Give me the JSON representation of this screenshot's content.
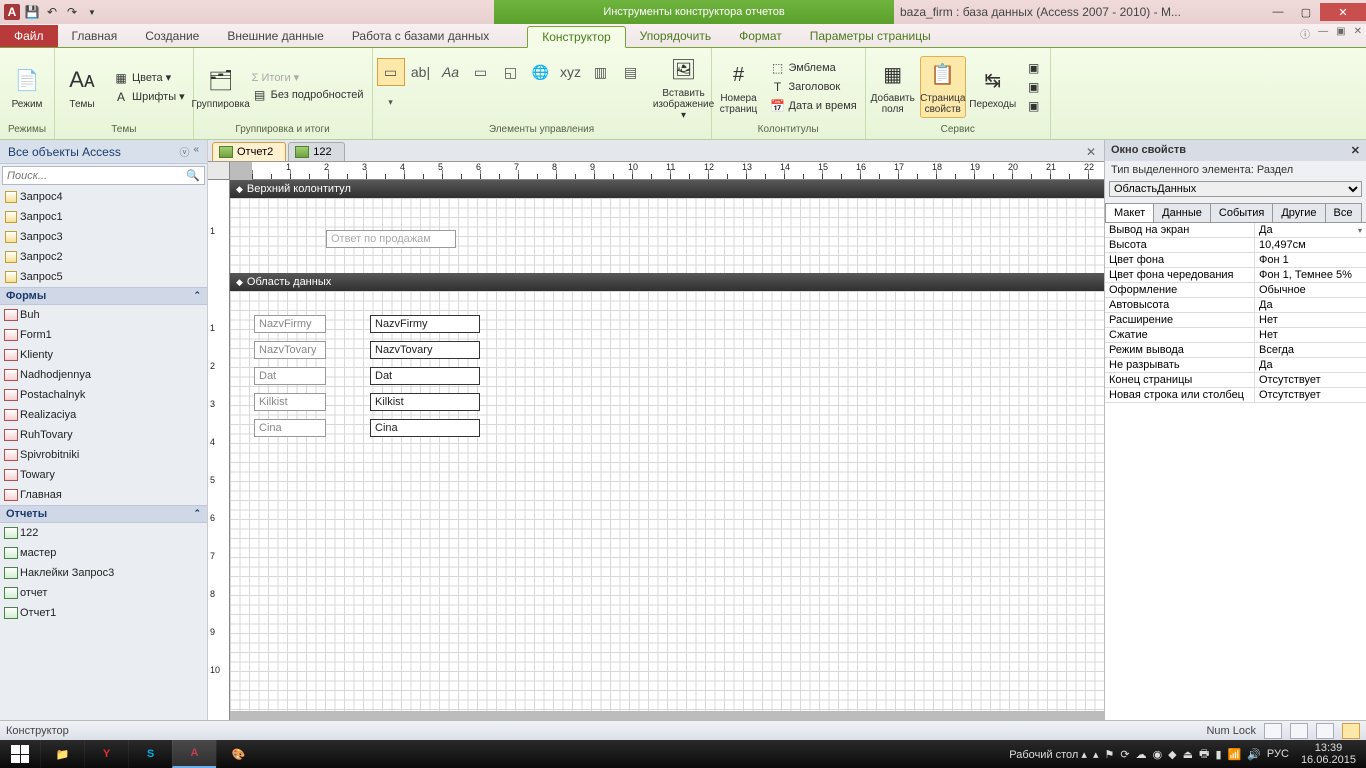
{
  "window": {
    "context_tab_title": "Инструменты конструктора отчетов",
    "doc_title": "baza_firm : база данных (Access 2007 - 2010) - M...",
    "min": "—",
    "max": "▢",
    "close": "✕"
  },
  "ribbon_tabs": {
    "file": "Файл",
    "home": "Главная",
    "create": "Создание",
    "external": "Внешние данные",
    "dbtools": "Работа с базами данных",
    "designer": "Конструктор",
    "arrange": "Упорядочить",
    "format": "Формат",
    "pagesetup": "Параметры страницы"
  },
  "ribbon": {
    "modes": {
      "view": "Режим",
      "group": "Режимы"
    },
    "themes": {
      "themes": "Темы",
      "colors": "Цвета",
      "fonts": "Шрифты",
      "group": "Темы"
    },
    "grouping": {
      "groupby": "Группировка",
      "totals": "Σ Итоги ▾",
      "details": "Без подробностей",
      "group": "Группировка и итоги"
    },
    "controls": {
      "insert_image": "Вставить изображение ▾",
      "group": "Элементы управления"
    },
    "headerfooter": {
      "page_numbers": "Номера страниц",
      "logo": "Эмблема",
      "title": "Заголовок",
      "datetime": "Дата и время",
      "group": "Колонтитулы"
    },
    "tools": {
      "add_fields": "Добавить поля",
      "prop_sheet": "Страница свойств",
      "tab_order": "Переходы",
      "group": "Сервис"
    }
  },
  "navpane": {
    "title": "Все объекты Access",
    "search_placeholder": "Поиск...",
    "queries": [
      "Запрос4",
      "Запрос1",
      "Запрос3",
      "Запрос2",
      "Запрос5"
    ],
    "forms_header": "Формы",
    "forms": [
      "Buh",
      "Form1",
      "Klienty",
      "Nadhodjennya",
      "Postachalnyk",
      "Realizaciya",
      "RuhTovary",
      "Spivrobitniki",
      "Towary",
      "Главная"
    ],
    "reports_header": "Отчеты",
    "reports": [
      "122",
      "мастер",
      "Наклейки Запрос3",
      "отчет",
      "Отчет1"
    ]
  },
  "doc_tabs": {
    "tab1": "Отчет2",
    "tab2": "122"
  },
  "design": {
    "section_header": "Верхний колонтитул",
    "section_detail": "Область данных",
    "title_label": "Ответ по продажам",
    "labels": [
      "NazvFirmy",
      "NazvTovary",
      "Dat",
      "Kilkist",
      "Cina"
    ],
    "fields": [
      "NazvFirmy",
      "NazvTovary",
      "Dat",
      "Kilkist",
      "Cina"
    ]
  },
  "propsheet": {
    "title": "Окно свойств",
    "subtitle": "Тип выделенного элемента:  Раздел",
    "selection": "ОбластьДанных",
    "tabs": {
      "layout": "Макет",
      "data": "Данные",
      "events": "События",
      "other": "Другие",
      "all": "Все"
    },
    "rows": [
      {
        "k": "Вывод на экран",
        "v": "Да",
        "dd": true
      },
      {
        "k": "Высота",
        "v": "10,497см"
      },
      {
        "k": "Цвет фона",
        "v": "Фон 1"
      },
      {
        "k": "Цвет фона чередования",
        "v": "Фон 1, Темнее 5%"
      },
      {
        "k": "Оформление",
        "v": "Обычное"
      },
      {
        "k": "Автовысота",
        "v": "Да"
      },
      {
        "k": "Расширение",
        "v": "Нет"
      },
      {
        "k": "Сжатие",
        "v": "Нет"
      },
      {
        "k": "Режим вывода",
        "v": "Всегда"
      },
      {
        "k": "Не разрывать",
        "v": "Да"
      },
      {
        "k": "Конец страницы",
        "v": "Отсутствует"
      },
      {
        "k": "Новая строка или столбец",
        "v": "Отсутствует"
      }
    ]
  },
  "statusbar": {
    "mode": "Конструктор",
    "numlock": "Num Lock"
  },
  "taskbar": {
    "desktop": "Рабочий стол",
    "lang": "РУС",
    "time": "13:39",
    "date": "16.06.2015"
  }
}
